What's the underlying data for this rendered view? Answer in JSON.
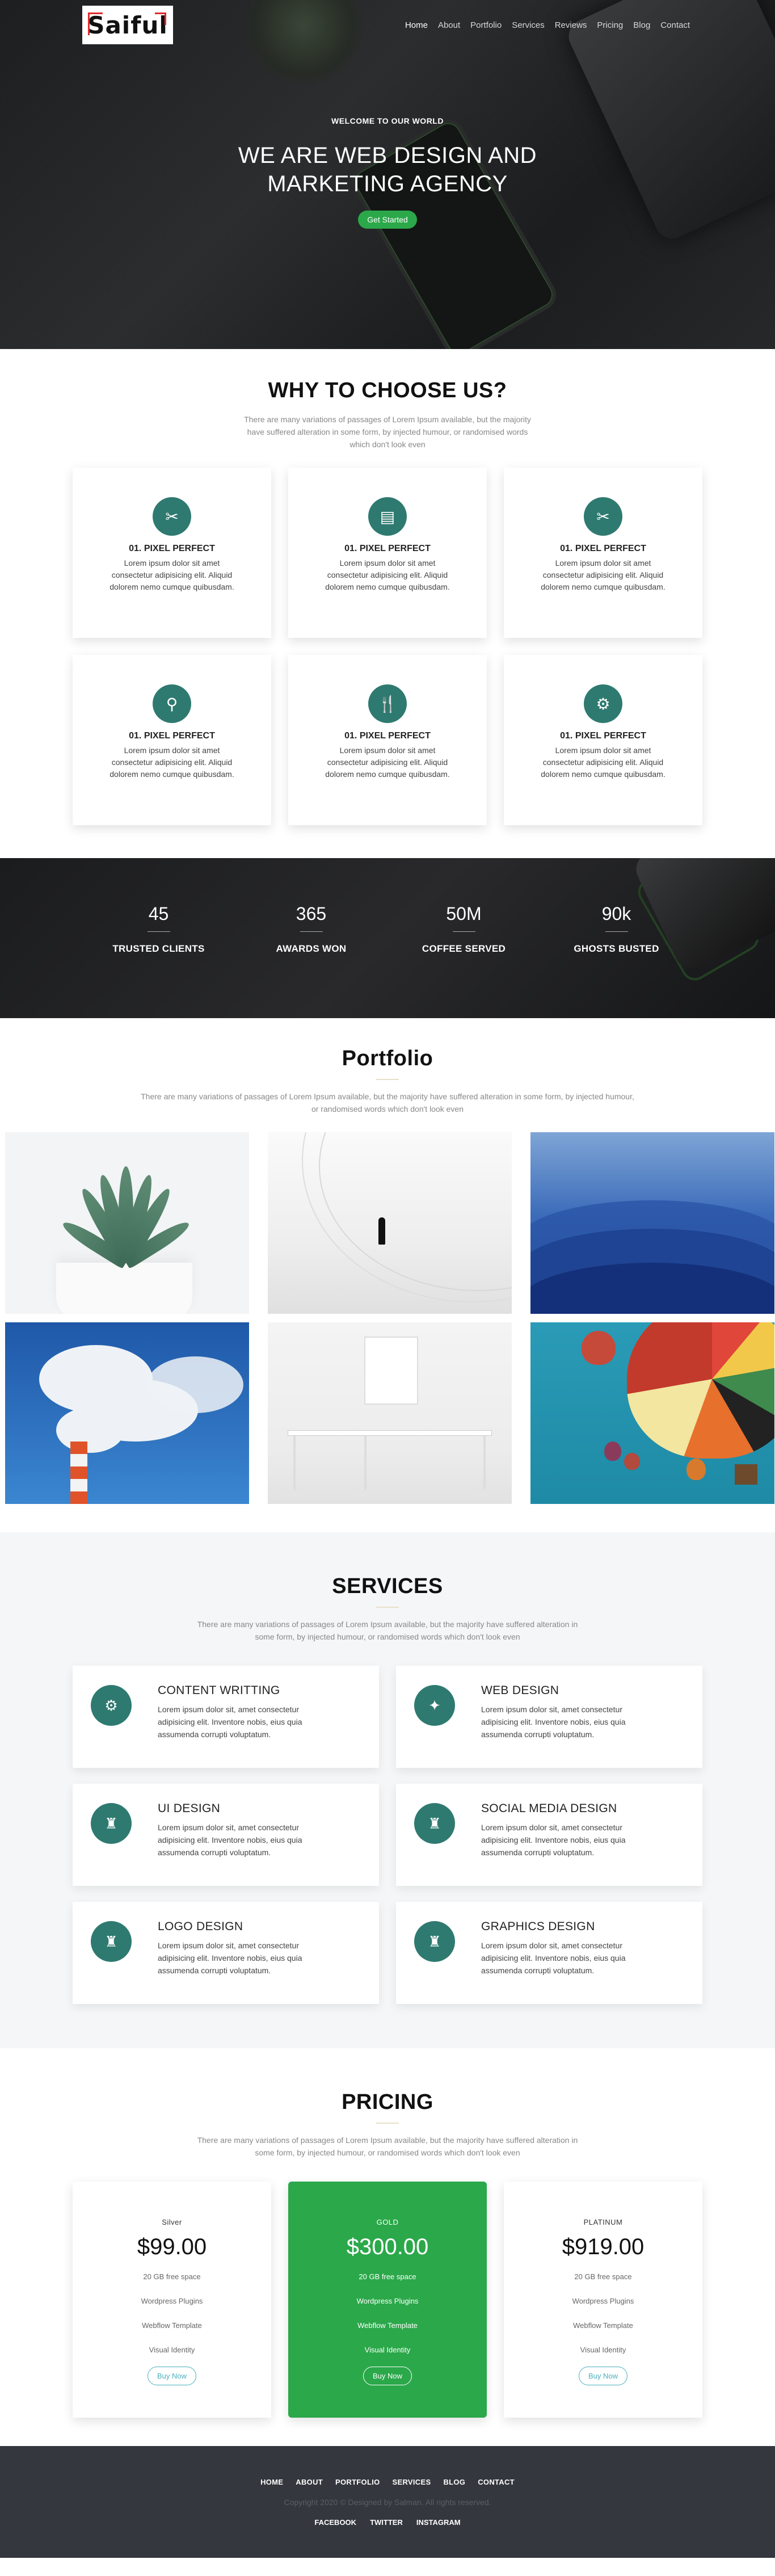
{
  "header": {
    "logo_text": "Saiful",
    "nav": [
      "Home",
      "About",
      "Portfolio",
      "Services",
      "Reviews",
      "Pricing",
      "Blog",
      "Contact"
    ]
  },
  "hero": {
    "subtitle": "WELCOME TO OUR WORLD",
    "title_line1": "WE ARE WEB DESIGN AND",
    "title_line2": "MARKETING AGENCY",
    "cta": "Get Started"
  },
  "why": {
    "title": "WHY TO CHOOSE US?",
    "description": "There are many variations of passages of Lorem Ipsum available, but the majority have suffered alteration in some form, by injected humour, or randomised words which don't look even",
    "features": [
      {
        "icon": "tools-icon",
        "glyph": "✂",
        "title": "01. PIXEL PERFECT",
        "text": "Lorem ipsum dolor sit amet consectetur adipisicing elit. Aliquid dolorem nemo cumque quibusdam."
      },
      {
        "icon": "window-icon",
        "glyph": "▤",
        "title": "01. PIXEL PERFECT",
        "text": "Lorem ipsum dolor sit amet consectetur adipisicing elit. Aliquid dolorem nemo cumque quibusdam."
      },
      {
        "icon": "tools-icon",
        "glyph": "✂",
        "title": "01. PIXEL PERFECT",
        "text": "Lorem ipsum dolor sit amet consectetur adipisicing elit. Aliquid dolorem nemo cumque quibusdam."
      },
      {
        "icon": "search-icon",
        "glyph": "⚲",
        "title": "01. PIXEL PERFECT",
        "text": "Lorem ipsum dolor sit amet consectetur adipisicing elit. Aliquid dolorem nemo cumque quibusdam."
      },
      {
        "icon": "cutlery-icon",
        "glyph": "🍴",
        "title": "01. PIXEL PERFECT",
        "text": "Lorem ipsum dolor sit amet consectetur adipisicing elit. Aliquid dolorem nemo cumque quibusdam."
      },
      {
        "icon": "gear-icon",
        "glyph": "⚙",
        "title": "01. PIXEL PERFECT",
        "text": "Lorem ipsum dolor sit amet consectetur adipisicing elit. Aliquid dolorem nemo cumque quibusdam."
      }
    ]
  },
  "stats": [
    {
      "value": "45",
      "label": "TRUSTED CLIENTS"
    },
    {
      "value": "365",
      "label": "AWARDS WON"
    },
    {
      "value": "50M",
      "label": "COFFEE SERVED"
    },
    {
      "value": "90k",
      "label": "GHOSTS BUSTED"
    }
  ],
  "portfolio": {
    "title": "Portfolio",
    "description": "There are many variations of passages of Lorem Ipsum available, but the majority have suffered alteration in some form, by injected humour, or randomised words which don't look even"
  },
  "services": {
    "title": "SERVICES",
    "description": "There are many variations of passages of Lorem Ipsum available, but the majority have suffered alteration in some form, by injected humour, or randomised words which don't look even",
    "items": [
      {
        "icon": "gear-icon",
        "glyph": "⚙",
        "title": "CONTENT WRITTING",
        "text": "Lorem ipsum dolor sit, amet consectetur adipisicing elit. Inventore nobis, eius quia assumenda corrupti voluptatum."
      },
      {
        "icon": "magic-icon",
        "glyph": "✦",
        "title": "WEB DESIGN",
        "text": "Lorem ipsum dolor sit, amet consectetur adipisicing elit. Inventore nobis, eius quia assumenda corrupti voluptatum."
      },
      {
        "icon": "chess-icon",
        "glyph": "♜",
        "title": "UI DESIGN",
        "text": "Lorem ipsum dolor sit, amet consectetur adipisicing elit. Inventore nobis, eius quia assumenda corrupti voluptatum."
      },
      {
        "icon": "chess-icon",
        "glyph": "♜",
        "title": "SOCIAL MEDIA DESIGN",
        "text": "Lorem ipsum dolor sit, amet consectetur adipisicing elit. Inventore nobis, eius quia assumenda corrupti voluptatum."
      },
      {
        "icon": "chess-icon",
        "glyph": "♜",
        "title": "LOGO DESIGN",
        "text": "Lorem ipsum dolor sit, amet consectetur adipisicing elit. Inventore nobis, eius quia assumenda corrupti voluptatum."
      },
      {
        "icon": "chess-icon",
        "glyph": "♜",
        "title": "GRAPHICS DESIGN",
        "text": "Lorem ipsum dolor sit, amet consectetur adipisicing elit. Inventore nobis, eius quia assumenda corrupti voluptatum."
      }
    ]
  },
  "pricing": {
    "title": "PRICING",
    "description": "There are many variations of passages of Lorem Ipsum available, but the majority have suffered alteration in some form, by injected humour, or randomised words which don't look even",
    "plans": [
      {
        "name": "Silver",
        "price": "$99.00",
        "features": [
          "20 GB free space",
          "Wordpress Plugins",
          "Webflow Template",
          "Visual Identity"
        ],
        "button": "Buy Now"
      },
      {
        "name": "GOLD",
        "price": "$300.00",
        "features": [
          "20 GB free space",
          "Wordpress Plugins",
          "Webflow Template",
          "Visual Identity"
        ],
        "button": "Buy Now"
      },
      {
        "name": "PLATINUM",
        "price": "$919.00",
        "features": [
          "20 GB free space",
          "Wordpress Plugins",
          "Webflow Template",
          "Visual Identity"
        ],
        "button": "Buy Now"
      }
    ]
  },
  "footer": {
    "nav": [
      "HOME",
      "ABOUT",
      "PORTFOLIO",
      "SERVICES",
      "BLOG",
      "CONTACT"
    ],
    "copyright": "Copyright 2020 © Designed by Salman. All rights reserved.",
    "social": [
      "FACEBOOK",
      "TWITTER",
      "INSTAGRAM"
    ]
  },
  "colors": {
    "accent_green": "#2ba84a",
    "icon_teal": "#2e7a70",
    "footer_bg": "#34373d"
  }
}
